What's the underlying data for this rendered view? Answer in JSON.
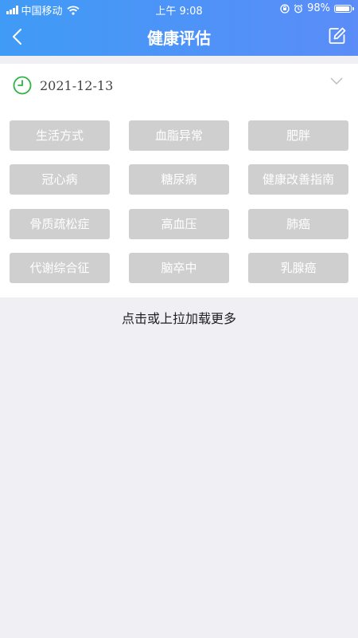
{
  "status_bar": {
    "carrier": "中国移动",
    "time": "上午 9:08",
    "battery": "98%",
    "battery_level": 0.98
  },
  "nav": {
    "title": "健康评估",
    "back_icon": "chevron-left-icon",
    "edit_icon": "edit-icon"
  },
  "record": {
    "date": "2021-12-13",
    "expand_icon": "chevron-down-icon"
  },
  "tags": [
    {
      "label": "生活方式"
    },
    {
      "label": "血脂异常"
    },
    {
      "label": "肥胖"
    },
    {
      "label": "冠心病"
    },
    {
      "label": "糖尿病"
    },
    {
      "label": "健康改善指南"
    },
    {
      "label": "骨质疏松症"
    },
    {
      "label": "高血压"
    },
    {
      "label": "肺癌"
    },
    {
      "label": "代谢综合征"
    },
    {
      "label": "脑卒中"
    },
    {
      "label": "乳腺癌"
    }
  ],
  "load_more": "点击或上拉加载更多",
  "colors": {
    "header_start": "#3f9bf6",
    "header_end": "#5b8cf8",
    "tag_bg": "#cfcfcf",
    "clock_green": "#2fb344"
  }
}
